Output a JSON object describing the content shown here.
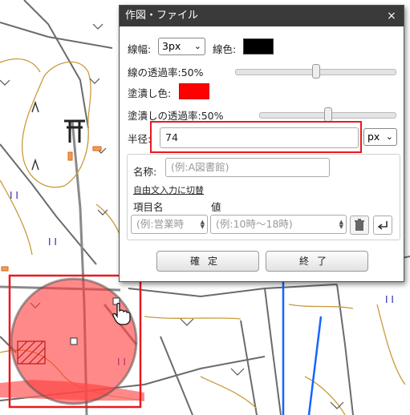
{
  "dialog": {
    "title": "作図・ファイル",
    "close_glyph": "×",
    "line_width_label": "線幅:",
    "line_width_value": "3px",
    "line_color_label": "線色:",
    "line_color": "#000000",
    "line_opacity_label": "線の透過率:50%",
    "line_opacity": 0.5,
    "fill_color_label": "塗潰し色:",
    "fill_color": "#ff0000",
    "fill_opacity_label": "塗潰しの透過率:50%",
    "fill_opacity": 0.5,
    "radius_label": "半径:",
    "radius_value": "74",
    "radius_unit": "px",
    "name_label": "名称:",
    "name_placeholder": "(例:A図書館)",
    "freetext_link": "自由文入力に切替",
    "col_item_label": "項目名",
    "col_value_label": "値",
    "item_placeholder": "(例:営業時",
    "value_placeholder": "(例:10時～18時)",
    "confirm_label": "確定",
    "cancel_label": "終了"
  },
  "map": {
    "circle_fill": "#ff3b3b",
    "selection_color": "#e8191f"
  }
}
